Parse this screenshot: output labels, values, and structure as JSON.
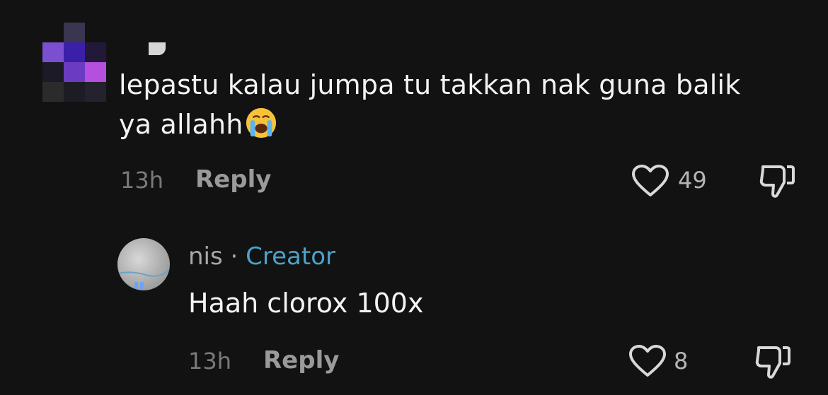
{
  "colors": {
    "background": "#121212",
    "creator_badge": "#4aa3c9",
    "muted": "#7a7a7a"
  },
  "comment": {
    "avatar": "pixelated-avatar",
    "text_line1": "lepastu kalau jumpa tu takkan nak guna balik",
    "text_line2": "ya allahh",
    "emoji": "loudly-crying-face-icon",
    "time": "13h",
    "reply_label": "Reply",
    "like_count": "49",
    "like_icon": "heart-outline-icon",
    "dislike_icon": "thumbs-down-icon"
  },
  "reply": {
    "author": "nis",
    "separator": "·",
    "badge": "Creator",
    "text": "Haah clorox 100x",
    "time": "13h",
    "reply_label": "Reply",
    "like_count": "8",
    "like_icon": "heart-outline-icon",
    "dislike_icon": "thumbs-down-icon"
  }
}
